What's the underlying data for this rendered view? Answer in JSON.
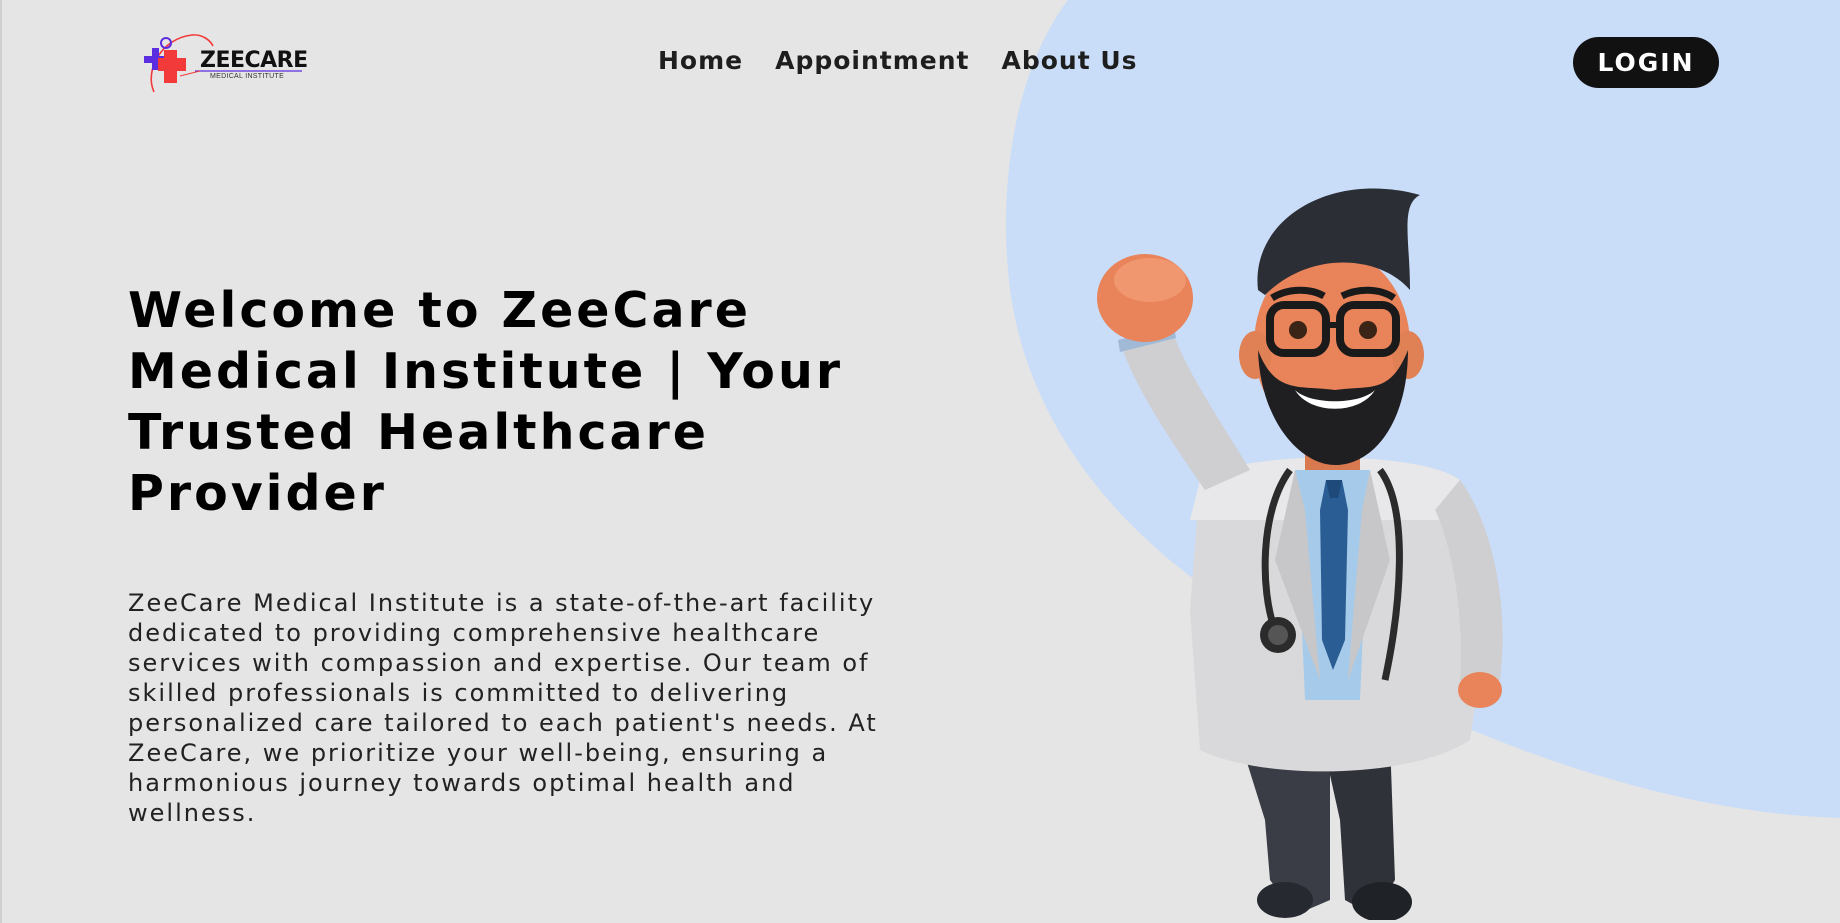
{
  "logo": {
    "name": "ZEECARE",
    "tagline": "MEDICAL INSTITUTE"
  },
  "nav": {
    "items": [
      {
        "label": "Home"
      },
      {
        "label": "Appointment"
      },
      {
        "label": "About Us"
      }
    ],
    "login_label": "LOGIN"
  },
  "hero": {
    "title": "Welcome to ZeeCare Medical Institute | Your Trusted Healthcare Provider",
    "description": "ZeeCare Medical Institute is a state-of-the-art facility dedicated to providing comprehensive healthcare services with compassion and expertise. Our team of skilled professionals is committed to delivering personalized care tailored to each patient's needs. At ZeeCare, we prioritize your well-being, ensuring a harmonious journey towards optimal health and wellness."
  },
  "colors": {
    "background": "#e5e5e5",
    "blob": "#c9dcf8",
    "login_bg": "#111111",
    "logo_red": "#f23a3a",
    "logo_purple": "#5b2de0"
  },
  "icons": {
    "logo_mark": "medical-cross-icon",
    "hero_illustration": "doctor-illustration"
  }
}
